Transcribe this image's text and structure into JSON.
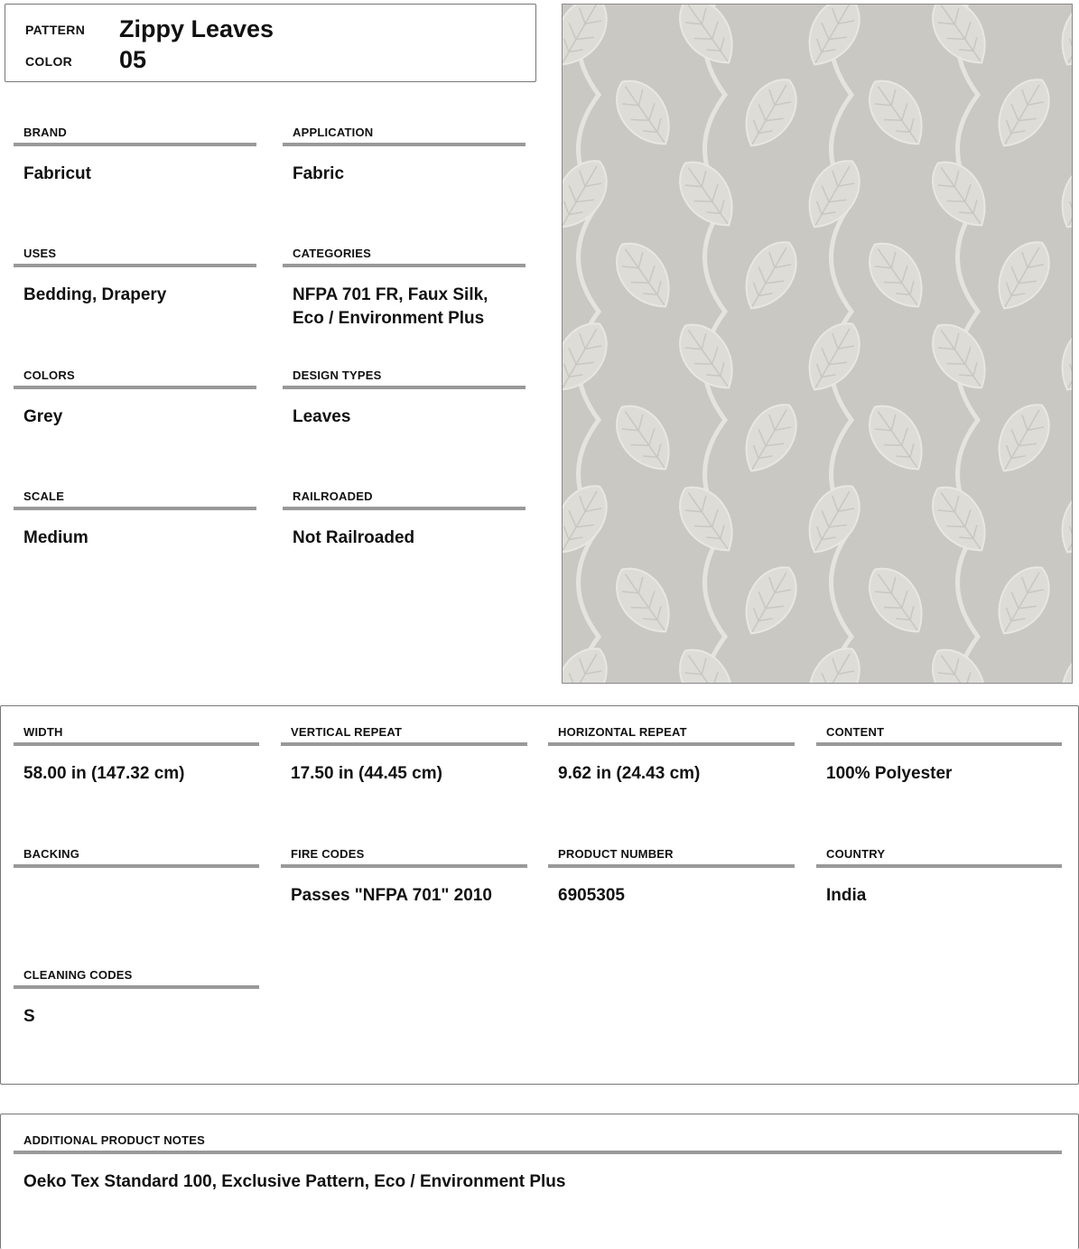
{
  "header": {
    "pattern_label": "PATTERN",
    "pattern_value": "Zippy Leaves",
    "color_label": "COLOR",
    "color_value": "05"
  },
  "details": [
    {
      "label": "BRAND",
      "value": "Fabricut"
    },
    {
      "label": "APPLICATION",
      "value": "Fabric"
    },
    {
      "label": "USES",
      "value": "Bedding, Drapery"
    },
    {
      "label": "CATEGORIES",
      "value_line1": "NFPA 701 FR, Faux Silk,",
      "value_line2": "Eco / Environment Plus"
    },
    {
      "label": "COLORS",
      "value": "Grey"
    },
    {
      "label": "DESIGN TYPES",
      "value": "Leaves"
    },
    {
      "label": "SCALE",
      "value": "Medium"
    },
    {
      "label": "RAILROADED",
      "value": "Not Railroaded"
    }
  ],
  "specs": [
    {
      "label": "WIDTH",
      "value": "58.00 in (147.32 cm)"
    },
    {
      "label": "VERTICAL REPEAT",
      "value": "17.50 in (44.45 cm)"
    },
    {
      "label": "HORIZONTAL REPEAT",
      "value": "9.62 in (24.43 cm)"
    },
    {
      "label": "CONTENT",
      "value": "100% Polyester"
    },
    {
      "label": "BACKING",
      "value": ""
    },
    {
      "label": "FIRE CODES",
      "value": "Passes \"NFPA 701\" 2010"
    },
    {
      "label": "PRODUCT NUMBER",
      "value": "6905305"
    },
    {
      "label": "COUNTRY",
      "value": "India"
    },
    {
      "label": "CLEANING CODES",
      "value": "S"
    }
  ],
  "notes": {
    "label": "ADDITIONAL PRODUCT NOTES",
    "value": "Oeko Tex Standard 100, Exclusive Pattern, Eco / Environment Plus"
  },
  "swatch": {
    "background_color": "#c9c8c3",
    "leaf_color": "#dddcd7",
    "vine_color": "#e4e3de"
  }
}
